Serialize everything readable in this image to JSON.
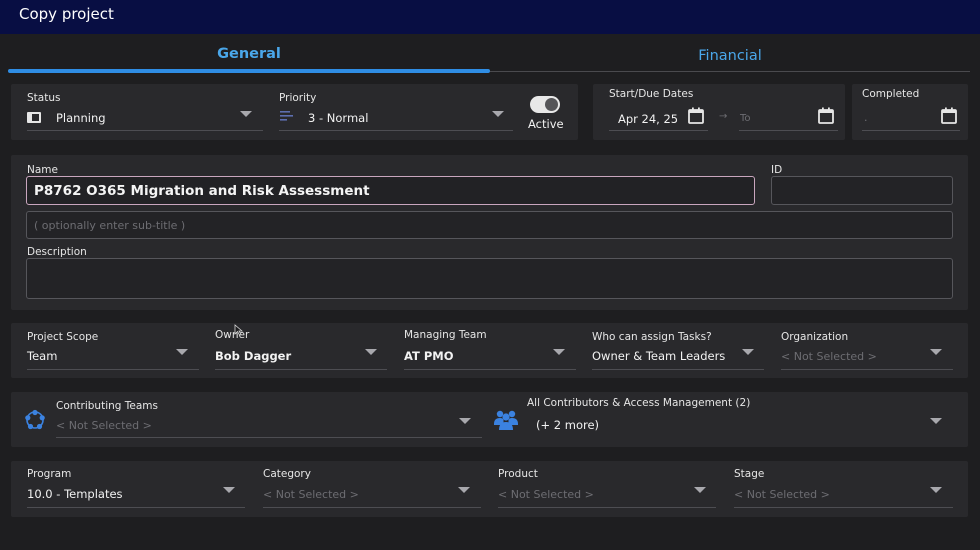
{
  "window": {
    "title": "Copy project"
  },
  "tabs": [
    {
      "label": "General"
    },
    {
      "label": "Financial"
    }
  ],
  "status": {
    "label": "Status",
    "value": "Planning"
  },
  "priority": {
    "label": "Priority",
    "value": "3 - Normal"
  },
  "active": {
    "label": "Active"
  },
  "dates": {
    "label": "Start/Due Dates",
    "start": "Apr 24, 25",
    "to_placeholder": "To"
  },
  "completed": {
    "label": "Completed",
    "value": "."
  },
  "name": {
    "label": "Name",
    "value": "P8762 O365 Migration and Risk Assessment"
  },
  "id_field": {
    "label": "ID"
  },
  "subtitle": {
    "placeholder": "( optionally enter sub-title )"
  },
  "description": {
    "label": "Description"
  },
  "scope": {
    "label": "Project Scope",
    "value": "Team"
  },
  "owner": {
    "label": "Owner",
    "value": "Bob Dagger"
  },
  "managing_team": {
    "label": "Managing Team",
    "value": "AT PMO"
  },
  "assign_tasks": {
    "label": "Who can assign Tasks?",
    "value": "Owner & Team Leaders"
  },
  "organization": {
    "label": "Organization",
    "value": "< Not Selected >"
  },
  "contributing": {
    "label": "Contributing Teams",
    "value": "< Not Selected >"
  },
  "access": {
    "label": "All Contributors & Access Management (2)",
    "value": "(+ 2 more)"
  },
  "program": {
    "label": "Program",
    "value": "10.0 - Templates"
  },
  "category": {
    "label": "Category",
    "value": "< Not Selected >"
  },
  "product": {
    "label": "Product",
    "value": "< Not Selected >"
  },
  "stage": {
    "label": "Stage",
    "value": "< Not Selected >"
  },
  "colors": {
    "titlebar": "#080e43",
    "accent": "#2f8de4",
    "tab_text": "#4aa7ea",
    "panel": "#29292c",
    "background": "#1e1e20"
  }
}
